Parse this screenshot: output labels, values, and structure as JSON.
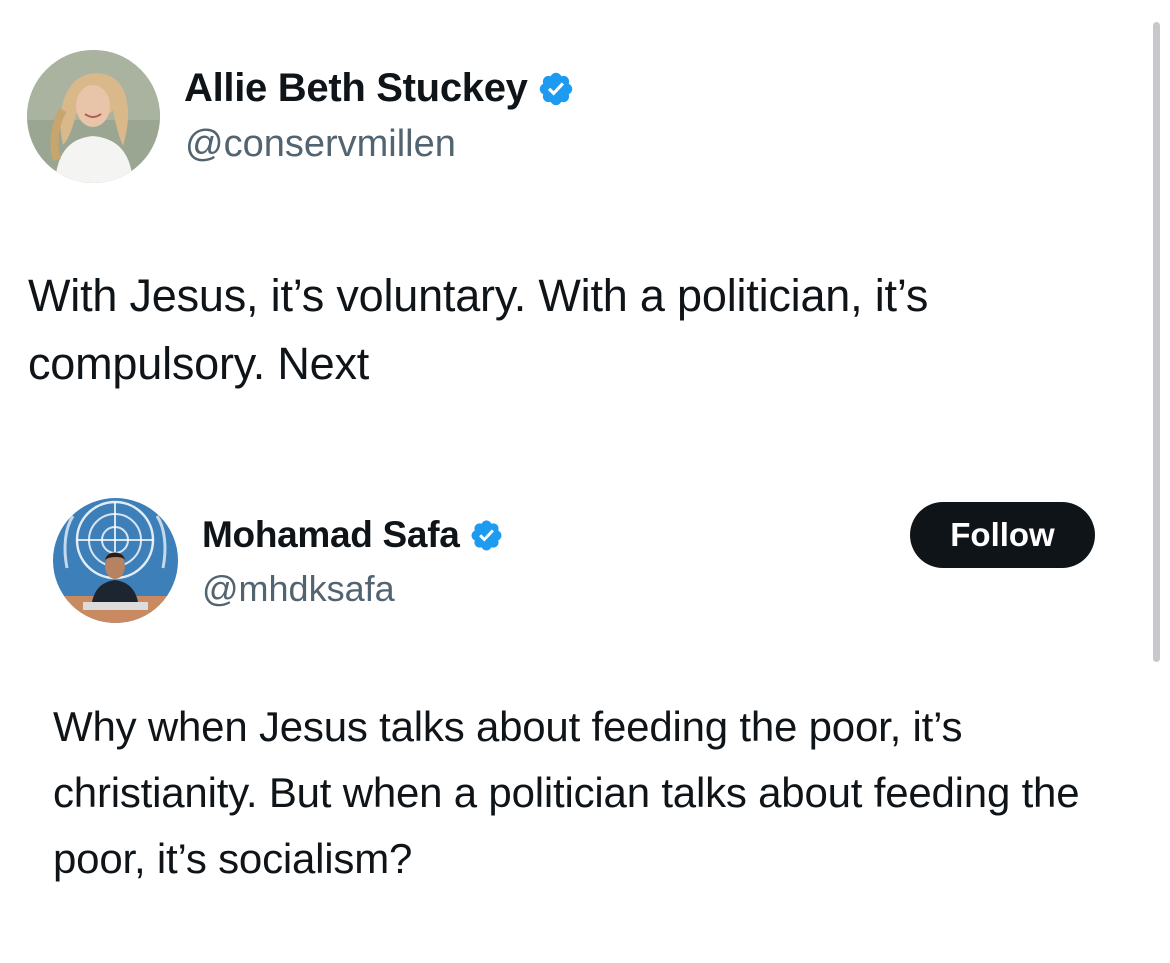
{
  "tweet": {
    "author_name": "Allie Beth Stuckey",
    "handle": "@conservmillen",
    "verified": true,
    "text": "With Jesus, it’s voluntary. With a politician, it’s compulsory. Next"
  },
  "quoted_tweet": {
    "author_name": "Mohamad Safa",
    "handle": "@mhdksafa",
    "verified": true,
    "follow_label": "Follow",
    "text": "Why when Jesus talks about feeding the poor, it’s christianity. But when a politician talks about feeding the poor, it’s socialism?"
  },
  "colors": {
    "verified_badge": "#1d9bf0",
    "follow_button_bg": "#0f1419",
    "handle_text": "#536471"
  },
  "icons": {
    "verified": "verified-badge-icon"
  }
}
